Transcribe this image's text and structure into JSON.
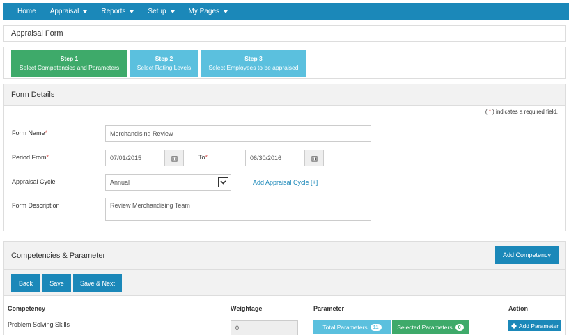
{
  "nav": {
    "items": [
      {
        "label": "Home",
        "dropdown": false
      },
      {
        "label": "Appraisal",
        "dropdown": true
      },
      {
        "label": "Reports",
        "dropdown": true
      },
      {
        "label": "Setup",
        "dropdown": true
      },
      {
        "label": "My Pages",
        "dropdown": true
      }
    ]
  },
  "page": {
    "title": "Appraisal Form"
  },
  "steps": [
    {
      "number": "Step 1",
      "label": "Select Competencies and Parameters",
      "active": true
    },
    {
      "number": "Step 2",
      "label": "Select Rating Levels",
      "active": false
    },
    {
      "number": "Step 3",
      "label": "Select Employees to be appraised",
      "active": false
    }
  ],
  "form_details": {
    "header": "Form Details",
    "required_note_prefix": "(",
    "required_star": "*",
    "required_note_suffix": ") indicates a required field.",
    "form_name_label": "Form Name",
    "form_name_value": "Merchandising Review",
    "period_from_label": "Period From",
    "period_from_value": "07/01/2015",
    "to_label": "To",
    "to_value": "06/30/2016",
    "cycle_label": "Appraisal Cycle",
    "cycle_value": "Annual",
    "add_cycle_link": "Add Appraisal Cycle [+]",
    "description_label": "Form Description",
    "description_value": "Review Merchandising Team"
  },
  "competencies": {
    "header": "Competencies & Parameter",
    "add_button": "Add Competency",
    "back_button": "Back",
    "save_button": "Save",
    "save_next_button": "Save & Next",
    "columns": [
      "Competency",
      "Weightage",
      "Parameter",
      "Action"
    ],
    "rows": [
      {
        "competency": "Problem Solving Skills",
        "weightage": "0",
        "total_params_label": "Total Parameters",
        "total_params_count": "11",
        "selected_params_label": "Selected Parameters",
        "selected_params_count": "0",
        "action_label": "Add Parameter"
      }
    ]
  },
  "colors": {
    "primary": "#1b88b9",
    "success": "#3eaa6a",
    "info": "#5bc0de",
    "required": "#d9534f"
  }
}
